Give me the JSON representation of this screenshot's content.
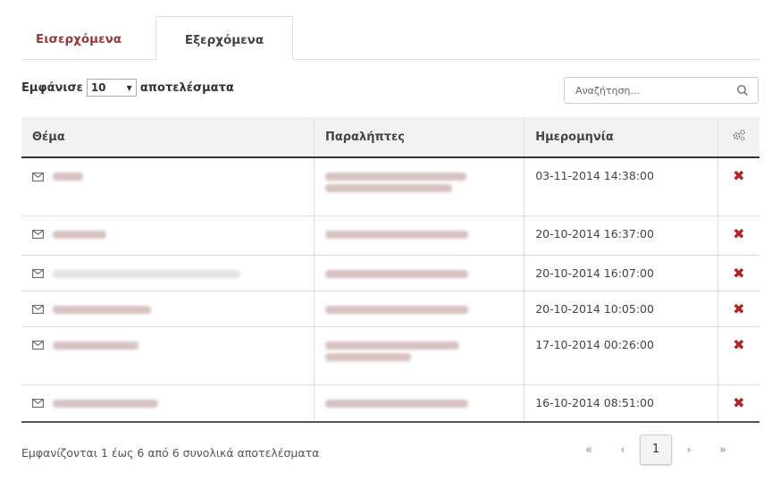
{
  "tabs": {
    "inbox": "Εισερχόμενα",
    "outbox": "Εξερχόμενα"
  },
  "controls": {
    "show_label": "Εμφάνισε",
    "page_size": "10",
    "results_label": "αποτελέσματα"
  },
  "search": {
    "placeholder": "Αναζήτηση..."
  },
  "table": {
    "headers": {
      "subject": "Θέμα",
      "recipients": "Παραλήπτες",
      "date": "Ημερομηνία"
    },
    "rows": [
      {
        "date": "03-11-2014 14:38:00"
      },
      {
        "date": "20-10-2014 16:37:00"
      },
      {
        "date": "20-10-2014 16:07:00"
      },
      {
        "date": "20-10-2014 10:05:00"
      },
      {
        "date": "17-10-2014 00:26:00"
      },
      {
        "date": "16-10-2014 08:51:00"
      }
    ]
  },
  "footer": {
    "info": "Εμφανίζονται 1 έως 6 από 6 συνολικά αποτελέσματα"
  },
  "pager": {
    "first": "«",
    "prev": "‹",
    "current": "1",
    "next": "›",
    "last": "»"
  },
  "colors": {
    "accent": "#9b3a3a",
    "delete": "#b22222"
  }
}
